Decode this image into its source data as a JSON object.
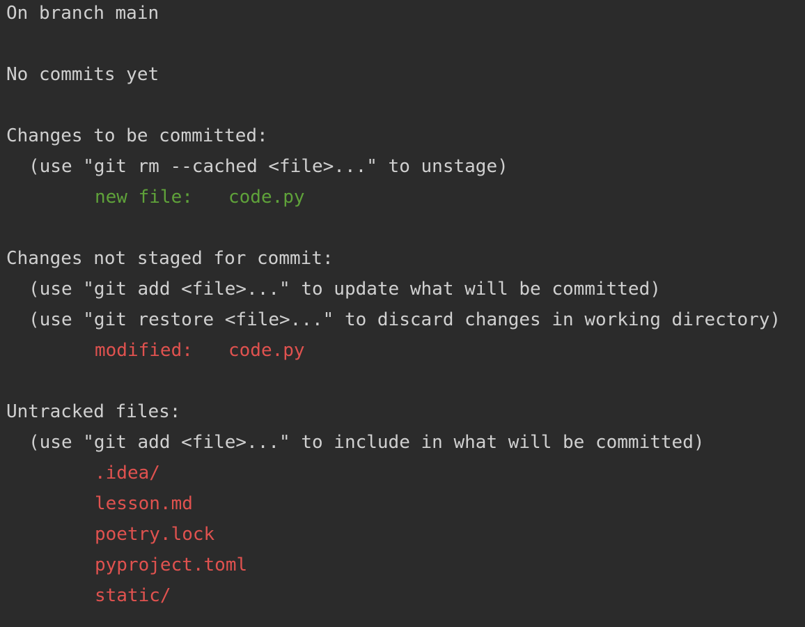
{
  "status": {
    "branch_line": "On branch main",
    "commits_line": "No commits yet",
    "staged": {
      "header": "Changes to be committed:",
      "hint": "(use \"git rm --cached <file>...\" to unstage)",
      "entries": [
        {
          "label": "new file:",
          "file": "code.py"
        }
      ]
    },
    "unstaged": {
      "header": "Changes not staged for commit:",
      "hints": [
        "(use \"git add <file>...\" to update what will be committed)",
        "(use \"git restore <file>...\" to discard changes in working directory)"
      ],
      "entries": [
        {
          "label": "modified:",
          "file": "code.py"
        }
      ]
    },
    "untracked": {
      "header": "Untracked files:",
      "hint": "(use \"git add <file>...\" to include in what will be committed)",
      "files": [
        ".idea/",
        "lesson.md",
        "poetry.lock",
        "pyproject.toml",
        "static/"
      ]
    }
  },
  "colors": {
    "background": "#2b2b2b",
    "text": "#d0d0d0",
    "staged": "#5fa23a",
    "unstaged": "#e0524f"
  }
}
